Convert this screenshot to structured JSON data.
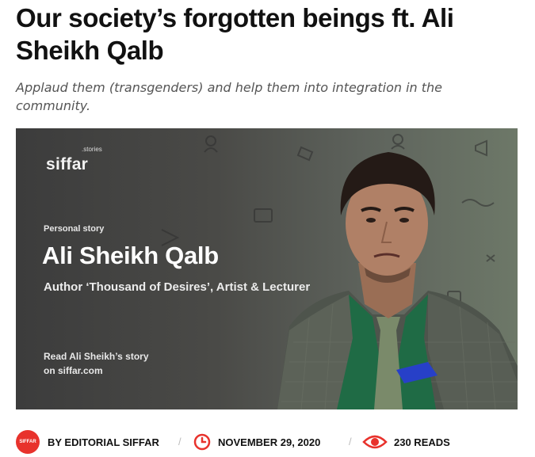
{
  "article": {
    "title": "Our society’s forgotten beings ft. Ali Sheikh Qalb",
    "subtitle": "Applaud them (transgenders) and help them into integration in the community."
  },
  "banner": {
    "brand_small": ".stories",
    "brand": "siffar",
    "kicker": "Personal story",
    "name": "Ali Sheikh Qalb",
    "subline": "Author ‘Thousand of Desires’, Artist & Lecturer",
    "cta_line1": "Read Ali Sheikh’s story",
    "cta_line2": "on siffar.com"
  },
  "meta": {
    "avatar_text": "SIFFAR",
    "author": "BY EDITORIAL SIFFAR",
    "separator": "/",
    "date": "NOVEMBER 29, 2020",
    "reads": "230 READS",
    "icons": [
      "clock-icon",
      "eye-icon"
    ],
    "accent_color": "#e8322c"
  }
}
